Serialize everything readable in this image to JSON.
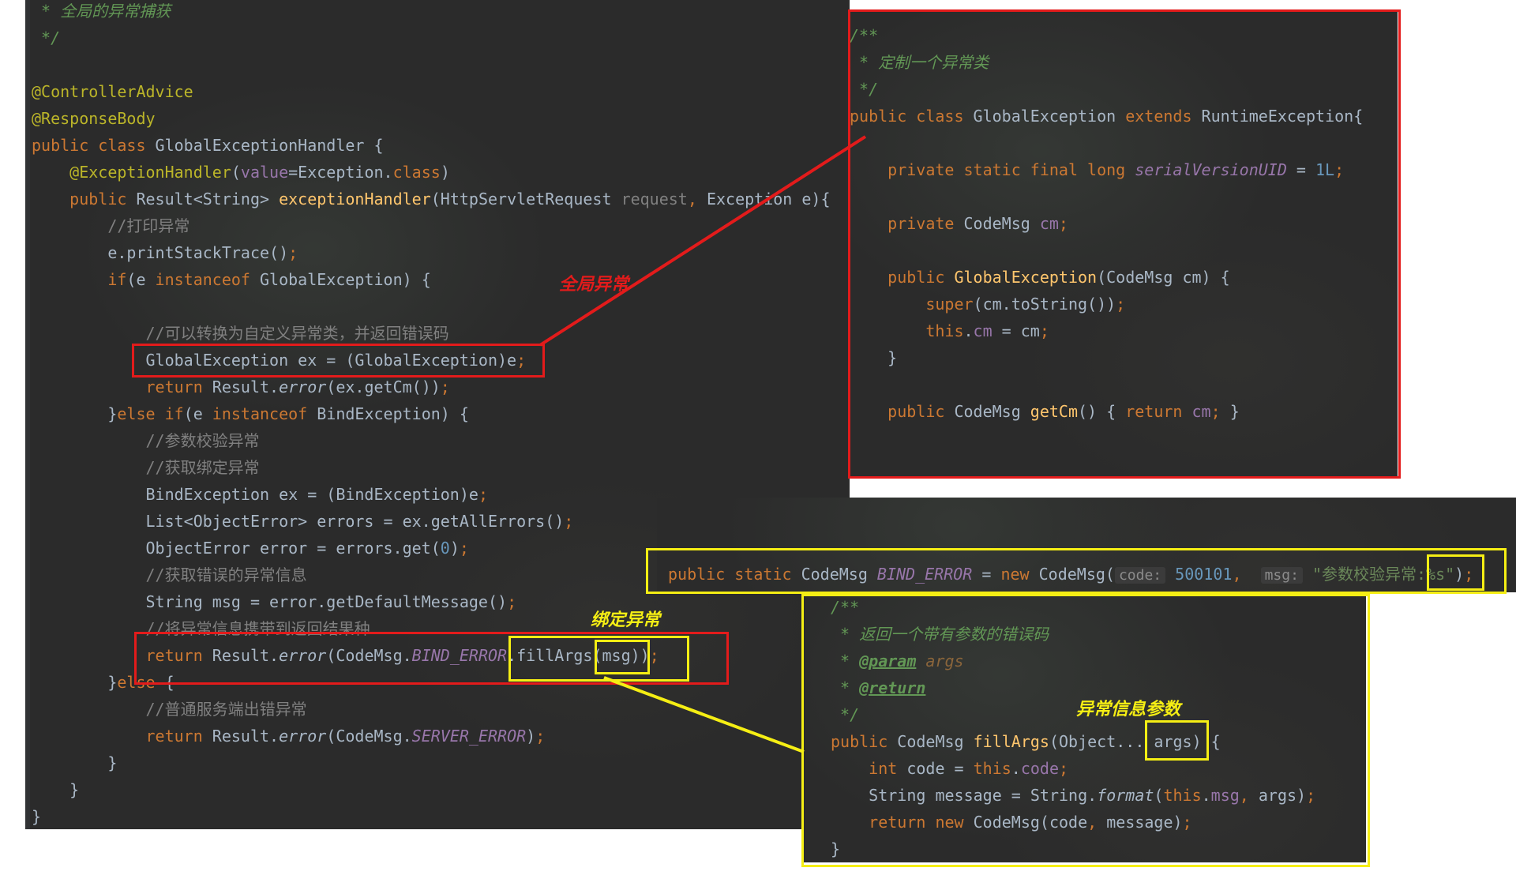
{
  "left_panel": {
    "lines": [
      {
        "segs": [
          [
            "doc",
            " * 全局的异常捕获"
          ]
        ]
      },
      {
        "segs": [
          [
            "doc",
            " */"
          ]
        ]
      },
      {
        "segs": [
          [
            "plain",
            ""
          ]
        ]
      },
      {
        "segs": [
          [
            "ann",
            "@ControllerAdvice"
          ]
        ]
      },
      {
        "segs": [
          [
            "ann",
            "@ResponseBody"
          ]
        ]
      },
      {
        "segs": [
          [
            "kw",
            "public class "
          ],
          [
            "plain",
            "GlobalExceptionHandler {"
          ]
        ]
      },
      {
        "segs": [
          [
            "ann",
            "    @ExceptionHandler"
          ],
          [
            "plain",
            "("
          ],
          [
            "field",
            "value"
          ],
          [
            "plain",
            "=Exception."
          ],
          [
            "kw",
            "class"
          ],
          [
            "plain",
            ")"
          ]
        ]
      },
      {
        "segs": [
          [
            "kw",
            "    public "
          ],
          [
            "plain",
            "Result<String> "
          ],
          [
            "fn",
            "exceptionHandler"
          ],
          [
            "plain",
            "(HttpServletRequest "
          ],
          [
            "param",
            "request"
          ],
          [
            "kw",
            ", "
          ],
          [
            "plain",
            "Exception e){"
          ]
        ]
      },
      {
        "segs": [
          [
            "cm",
            "        //打印异常"
          ]
        ]
      },
      {
        "segs": [
          [
            "plain",
            "        e.printStackTrace()"
          ],
          [
            "kw",
            ";"
          ]
        ]
      },
      {
        "segs": [
          [
            "kw",
            "        if"
          ],
          [
            "plain",
            "(e "
          ],
          [
            "kw",
            "instanceof "
          ],
          [
            "plain",
            "GlobalException) {"
          ]
        ]
      },
      {
        "segs": [
          [
            "plain",
            ""
          ]
        ]
      },
      {
        "segs": [
          [
            "cm",
            "            //可以转换为自定义异常类，并返回错误码"
          ]
        ]
      },
      {
        "segs": [
          [
            "plain",
            "            GlobalException ex = (GlobalException)e"
          ],
          [
            "kw",
            ";"
          ]
        ]
      },
      {
        "segs": [
          [
            "kw",
            "            return "
          ],
          [
            "plain",
            "Result."
          ],
          [
            "smeth",
            "error"
          ],
          [
            "plain",
            "(ex.getCm())"
          ],
          [
            "kw",
            ";"
          ]
        ]
      },
      {
        "segs": [
          [
            "plain",
            "        }"
          ],
          [
            "kw",
            "else if"
          ],
          [
            "plain",
            "(e "
          ],
          [
            "kw",
            "instanceof "
          ],
          [
            "plain",
            "BindException) {"
          ]
        ]
      },
      {
        "segs": [
          [
            "cm",
            "            //参数校验异常"
          ]
        ]
      },
      {
        "segs": [
          [
            "cm",
            "            //获取绑定异常"
          ]
        ]
      },
      {
        "segs": [
          [
            "plain",
            "            BindException ex = (BindException)e"
          ],
          [
            "kw",
            ";"
          ]
        ]
      },
      {
        "segs": [
          [
            "plain",
            "            List<ObjectError> errors = ex.getAllErrors()"
          ],
          [
            "kw",
            ";"
          ]
        ]
      },
      {
        "segs": [
          [
            "plain",
            "            ObjectError error = errors.get("
          ],
          [
            "num",
            "0"
          ],
          [
            "plain",
            ")"
          ],
          [
            "kw",
            ";"
          ]
        ]
      },
      {
        "segs": [
          [
            "cm",
            "            //获取错误的异常信息"
          ]
        ]
      },
      {
        "segs": [
          [
            "plain",
            "            String msg = error.getDefaultMessage()"
          ],
          [
            "kw",
            ";"
          ]
        ]
      },
      {
        "segs": [
          [
            "cm",
            "            //将异常信息携带到返回结果种"
          ]
        ]
      },
      {
        "segs": [
          [
            "kw",
            "            return "
          ],
          [
            "plain",
            "Result."
          ],
          [
            "smeth",
            "error"
          ],
          [
            "plain",
            "(CodeMsg."
          ],
          [
            "sfield",
            "BIND_ERROR"
          ],
          [
            "plain",
            ".fillArgs(msg))"
          ],
          [
            "kw",
            ";"
          ]
        ]
      },
      {
        "segs": [
          [
            "plain",
            "        }"
          ],
          [
            "kw",
            "else "
          ],
          [
            "plain",
            "{"
          ]
        ]
      },
      {
        "segs": [
          [
            "cm",
            "            //普通服务端出错异常"
          ]
        ]
      },
      {
        "segs": [
          [
            "kw",
            "            return "
          ],
          [
            "plain",
            "Result."
          ],
          [
            "smeth",
            "error"
          ],
          [
            "plain",
            "(CodeMsg."
          ],
          [
            "sfield",
            "SERVER_ERROR"
          ],
          [
            "plain",
            ")"
          ],
          [
            "kw",
            ";"
          ]
        ]
      },
      {
        "segs": [
          [
            "plain",
            "        }"
          ]
        ]
      },
      {
        "segs": [
          [
            "plain",
            "    }"
          ]
        ]
      },
      {
        "segs": [
          [
            "plain",
            "}"
          ]
        ]
      }
    ]
  },
  "right_top_panel": {
    "lines": [
      {
        "segs": [
          [
            "doc",
            "/**"
          ]
        ]
      },
      {
        "segs": [
          [
            "doc",
            " * 定制一个异常类"
          ]
        ]
      },
      {
        "segs": [
          [
            "doc",
            " */"
          ]
        ]
      },
      {
        "segs": [
          [
            "kw",
            "public class "
          ],
          [
            "plain",
            "GlobalException "
          ],
          [
            "kw",
            "extends "
          ],
          [
            "plain",
            "RuntimeException{"
          ]
        ]
      },
      {
        "segs": [
          [
            "plain",
            ""
          ]
        ]
      },
      {
        "segs": [
          [
            "kw",
            "    private static final long "
          ],
          [
            "sfield",
            "serialVersionUID"
          ],
          [
            "plain",
            " = "
          ],
          [
            "num",
            "1L"
          ],
          [
            "kw",
            ";"
          ]
        ]
      },
      {
        "segs": [
          [
            "plain",
            ""
          ]
        ]
      },
      {
        "segs": [
          [
            "kw",
            "    private "
          ],
          [
            "plain",
            "CodeMsg "
          ],
          [
            "field",
            "cm"
          ],
          [
            "kw",
            ";"
          ]
        ]
      },
      {
        "segs": [
          [
            "plain",
            ""
          ]
        ]
      },
      {
        "segs": [
          [
            "kw",
            "    public "
          ],
          [
            "fn",
            "GlobalException"
          ],
          [
            "plain",
            "(CodeMsg cm) {"
          ]
        ]
      },
      {
        "segs": [
          [
            "kw",
            "        super"
          ],
          [
            "plain",
            "(cm.toString())"
          ],
          [
            "kw",
            ";"
          ]
        ]
      },
      {
        "segs": [
          [
            "kw",
            "        this"
          ],
          [
            "plain",
            "."
          ],
          [
            "field",
            "cm"
          ],
          [
            "plain",
            " = cm"
          ],
          [
            "kw",
            ";"
          ]
        ]
      },
      {
        "segs": [
          [
            "plain",
            "    }"
          ]
        ]
      },
      {
        "segs": [
          [
            "plain",
            ""
          ]
        ]
      },
      {
        "segs": [
          [
            "kw",
            "    public "
          ],
          [
            "plain",
            "CodeMsg "
          ],
          [
            "fn",
            "getCm"
          ],
          [
            "plain",
            "() { "
          ],
          [
            "kw",
            "return "
          ],
          [
            "field",
            "cm"
          ],
          [
            "kw",
            "; "
          ],
          [
            "plain",
            "}"
          ]
        ]
      }
    ]
  },
  "bind_error_line": {
    "segs": [
      [
        "kw",
        "public static "
      ],
      [
        "plain",
        "CodeMsg "
      ],
      [
        "sfield",
        "BIND_ERROR"
      ],
      [
        "plain",
        " = "
      ],
      [
        "kw",
        "new "
      ],
      [
        "plain",
        "CodeMsg("
      ],
      [
        "hint",
        "code:"
      ],
      [
        "num",
        " 500101"
      ],
      [
        "kw",
        ",  "
      ],
      [
        "hint",
        "msg:"
      ],
      [
        "str",
        " \"参数校验异常:%s\""
      ],
      [
        "plain",
        ")"
      ],
      [
        "kw",
        ";"
      ]
    ]
  },
  "fillargs_panel": {
    "lines": [
      {
        "segs": [
          [
            "doc",
            "/**"
          ]
        ]
      },
      {
        "segs": [
          [
            "doc",
            " * 返回一个带有参数的错误码"
          ]
        ]
      },
      {
        "segs": [
          [
            "doc",
            " * "
          ],
          [
            "doctag",
            "@param"
          ],
          [
            "docparam",
            " args"
          ]
        ]
      },
      {
        "segs": [
          [
            "doc",
            " * "
          ],
          [
            "doctag",
            "@return"
          ]
        ]
      },
      {
        "segs": [
          [
            "doc",
            " */"
          ]
        ]
      },
      {
        "segs": [
          [
            "kw",
            "public "
          ],
          [
            "plain",
            "CodeMsg "
          ],
          [
            "fn",
            "fillArgs"
          ],
          [
            "plain",
            "(Object... args) {"
          ]
        ]
      },
      {
        "segs": [
          [
            "kw",
            "    int "
          ],
          [
            "plain",
            "code = "
          ],
          [
            "kw",
            "this"
          ],
          [
            "plain",
            "."
          ],
          [
            "field",
            "code"
          ],
          [
            "kw",
            ";"
          ]
        ]
      },
      {
        "segs": [
          [
            "plain",
            "    String message = String."
          ],
          [
            "smeth",
            "format"
          ],
          [
            "plain",
            "("
          ],
          [
            "kw",
            "this"
          ],
          [
            "plain",
            "."
          ],
          [
            "field",
            "msg"
          ],
          [
            "kw",
            ", "
          ],
          [
            "plain",
            "args)"
          ],
          [
            "kw",
            ";"
          ]
        ]
      },
      {
        "segs": [
          [
            "kw",
            "    return new "
          ],
          [
            "plain",
            "CodeMsg(code"
          ],
          [
            "kw",
            ", "
          ],
          [
            "plain",
            "message)"
          ],
          [
            "kw",
            ";"
          ]
        ]
      },
      {
        "segs": [
          [
            "plain",
            "}"
          ]
        ]
      }
    ]
  },
  "labels": {
    "global_exception": "全局异常",
    "bind_exception": "绑定异常",
    "exception_args": "异常信息参数"
  },
  "colors": {
    "red": "#e31b1b",
    "yellow": "#f5ee14",
    "editor_bg": "#2b2b2b"
  }
}
